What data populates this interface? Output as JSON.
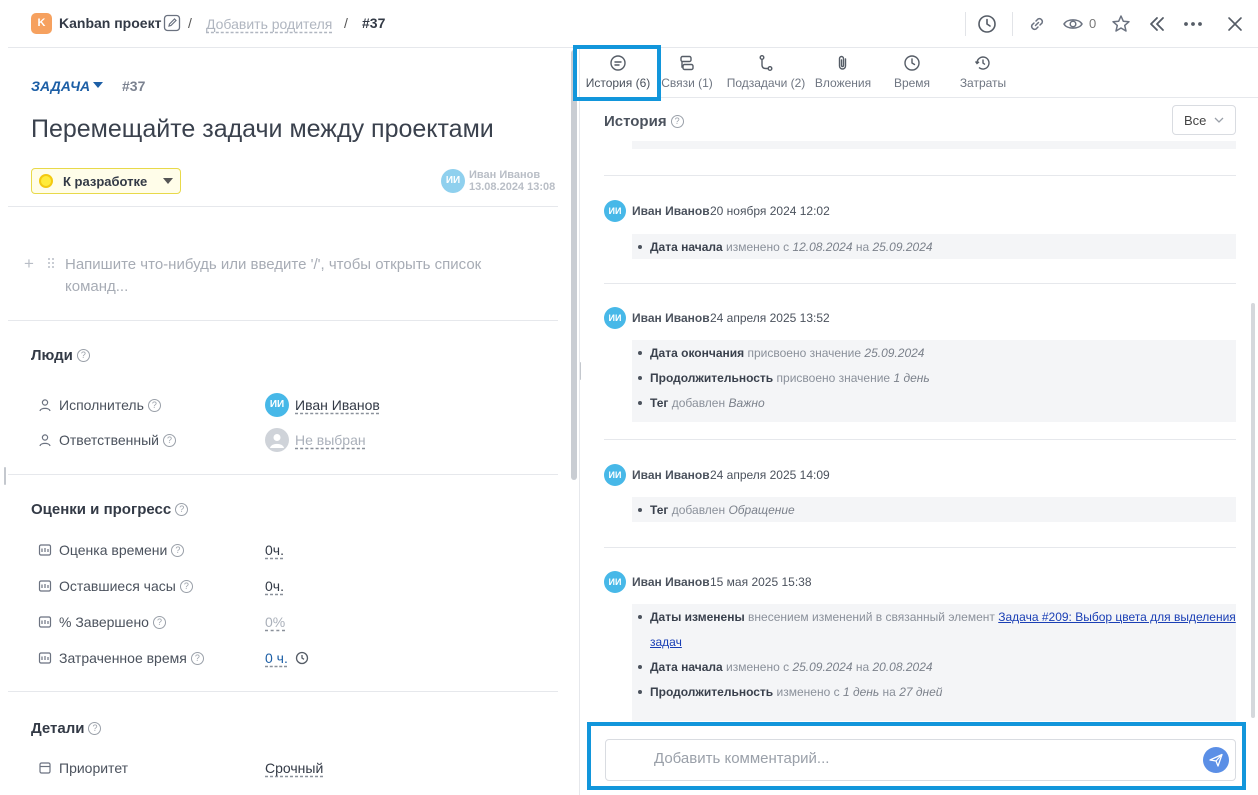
{
  "header": {
    "project_badge": "K",
    "project_name": "Kanban проект",
    "separator": "/",
    "add_parent": "Добавить родителя",
    "task_id": "#37",
    "watch_count": "0"
  },
  "task": {
    "type": "ЗАДАЧА",
    "id": "#37",
    "title": "Перемещайте задачи между проектами",
    "status": "К разработке",
    "status_color": "#ffeb3b",
    "author_initials": "ИИ",
    "author_name": "Иван Иванов",
    "author_date": "13.08.2024 13:08",
    "editor_placeholder": "Напишите что-нибудь или введите '/', чтобы открыть список команд..."
  },
  "people": {
    "title": "Люди",
    "assignee_label": "Исполнитель",
    "assignee_initials": "ИИ",
    "assignee_value": "Иван Иванов",
    "responsible_label": "Ответственный",
    "responsible_value": "Не выбран"
  },
  "estimates": {
    "title": "Оценки и прогресс",
    "rows": [
      {
        "label": "Оценка времени",
        "value": "0ч."
      },
      {
        "label": "Оставшиеся часы",
        "value": "0ч."
      },
      {
        "label": "% Завершено",
        "value": "0%"
      },
      {
        "label": "Затраченное время",
        "value": "0 ч."
      }
    ]
  },
  "details": {
    "title": "Детали",
    "priority_label": "Приоритет",
    "priority_value": "Срочный"
  },
  "tabs": [
    {
      "label": "История (6)",
      "icon": "history-icon"
    },
    {
      "label": "Связи (1)",
      "icon": "links-icon"
    },
    {
      "label": "Подзадачи (2)",
      "icon": "subtasks-icon"
    },
    {
      "label": "Вложения",
      "icon": "attachment-icon"
    },
    {
      "label": "Время",
      "icon": "clock-icon"
    },
    {
      "label": "Затраты",
      "icon": "costs-icon"
    }
  ],
  "history": {
    "title": "История",
    "filter": "Все",
    "entries": [
      {
        "initials": "ИИ",
        "user": "Иван Иванов",
        "time": "20 ноября 2024 12:02",
        "changes": [
          {
            "field": "Дата начала",
            "action": "изменено с",
            "from": "12.08.2024",
            "to_word": "на",
            "to": "25.09.2024"
          }
        ]
      },
      {
        "initials": "ИИ",
        "user": "Иван Иванов",
        "time": "24 апреля 2025 13:52",
        "changes": [
          {
            "field": "Дата окончания",
            "action": "присвоено значение",
            "value": "25.09.2024"
          },
          {
            "field": "Продолжительность",
            "action": "присвоено значение",
            "value": "1 день"
          },
          {
            "field": "Тег",
            "action": "добавлен",
            "value": "Важно"
          }
        ]
      },
      {
        "initials": "ИИ",
        "user": "Иван Иванов",
        "time": "24 апреля 2025 14:09",
        "changes": [
          {
            "field": "Тег",
            "action": "добавлен",
            "value": "Обращение"
          }
        ]
      },
      {
        "initials": "ИИ",
        "user": "Иван Иванов",
        "time": "15 мая 2025 15:38",
        "changes": [
          {
            "field": "Даты изменены",
            "action": "внесением изменений в связанный элемент",
            "link_part1": "Задача #209: Выбор цвета для выделения",
            "link_part2": "задач"
          },
          {
            "field": "Дата начала",
            "action": "изменено с",
            "from": "25.09.2024",
            "to_word": "на",
            "to": "20.08.2024"
          },
          {
            "field": "Продолжительность",
            "action": "изменено с",
            "from": "1 день",
            "to_word": "на",
            "to": "27 дней"
          }
        ]
      }
    ]
  },
  "comment": {
    "placeholder": "Добавить комментарий..."
  },
  "colors": {
    "accent": "#1d5fa6",
    "highlight": "#1296db",
    "avatar": "#47b8e8",
    "send_button": "#5b8fe6"
  }
}
